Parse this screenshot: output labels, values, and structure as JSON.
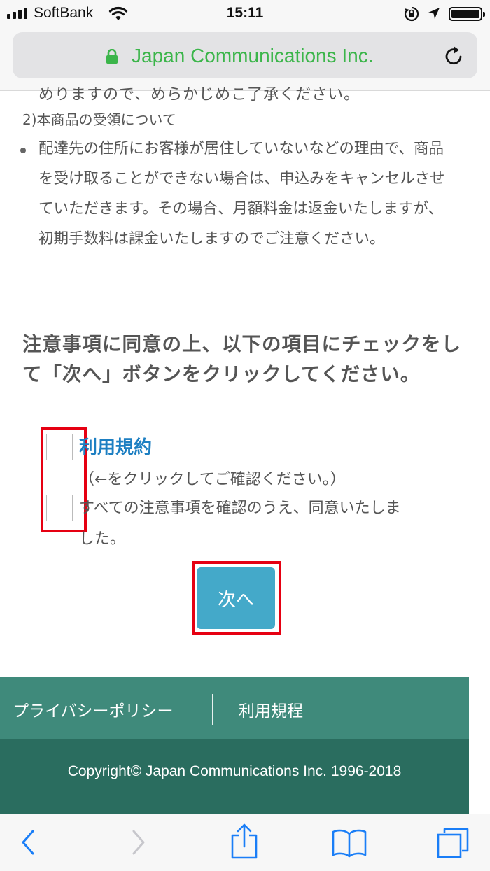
{
  "status_bar": {
    "carrier": "SoftBank",
    "time": "15:11"
  },
  "browser": {
    "url_text": "Japan Communications Inc."
  },
  "content": {
    "cutoff_text": "めりますので、めらかじめこ了承ください。",
    "section_title": "2)本商品の受領について",
    "bullet_text": "配達先の住所にお客様が居住していないなどの理由で、商品を受け取ることができない場合は、申込みをキャンセルさせていただきます。その場合、月額料金は返金いたしますが、初期手数料は課金いたしますのでご注意ください。",
    "instruction": "注意事項に同意の上、以下の項目にチェックをして「次へ」ボタンをクリックしてください。",
    "checkbox1_link": "利用規約",
    "checkbox1_note": "（←をクリックしてご確認ください。）",
    "checkbox2_label": "すべての注意事項を確認のうえ、同意いたしました。",
    "next_button": "次へ"
  },
  "footer": {
    "privacy_link": "プライバシーポリシー",
    "terms_link": "利用規程",
    "copyright": "Copyright© Japan Communications Inc. 1996-2018"
  },
  "colors": {
    "url_green": "#3bb54a",
    "link_blue": "#1d7fc2",
    "button_blue": "#44a9c9",
    "highlight_red": "#e60012",
    "footer_green": "#3f8a7b",
    "footer_dark_green": "#2a6d5f",
    "toolbar_icon_blue": "#1a7ef7"
  },
  "icons": [
    "signal-icon",
    "wifi-icon",
    "rotation-lock-icon",
    "location-icon",
    "battery-icon",
    "padlock-icon",
    "reload-icon",
    "back-icon",
    "forward-icon",
    "share-icon",
    "bookmarks-icon",
    "tabs-icon"
  ]
}
